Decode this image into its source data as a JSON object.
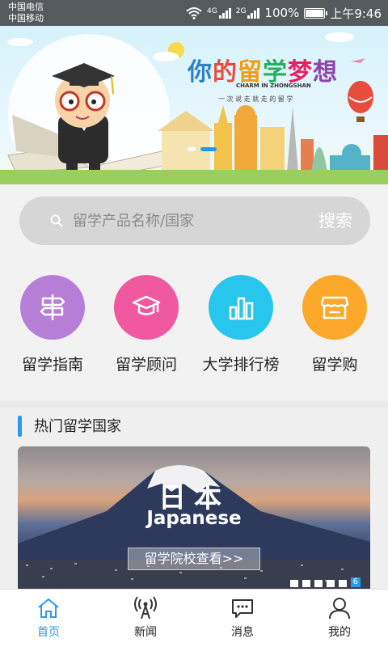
{
  "status_bar": {
    "carrier_1": "中国电信",
    "carrier_2": "中国移动",
    "net_1": "4G",
    "net_2": "2G",
    "battery": "100%",
    "time": "上午9:46"
  },
  "banner": {
    "title": [
      "你",
      "的",
      "留",
      "学",
      "梦",
      "想"
    ],
    "subtitle": "CHARM IN ZHONGSHAN",
    "slogan": "一 次 说 走 就 走 的 留 学"
  },
  "search": {
    "placeholder": "留学产品名称/国家",
    "button_label": "搜索"
  },
  "categories": [
    {
      "label": "留学指南",
      "color": "#b67ed6",
      "icon": "signpost-icon"
    },
    {
      "label": "留学顾问",
      "color": "#f058a0",
      "icon": "graduation-cap-icon"
    },
    {
      "label": "大学排行榜",
      "color": "#28c6ec",
      "icon": "bar-chart-icon"
    },
    {
      "label": "留学购",
      "color": "#fca82b",
      "icon": "storefront-icon"
    }
  ],
  "hot_countries": {
    "title": "热门留学国家",
    "card": {
      "country": "日本",
      "country_en": "Japanese",
      "link": "留学院校查看>>",
      "page_badge": "6"
    }
  },
  "bottom_nav": [
    {
      "label": "首页",
      "icon": "home-icon",
      "active": true
    },
    {
      "label": "新闻",
      "icon": "broadcast-icon",
      "active": false
    },
    {
      "label": "消息",
      "icon": "chat-icon",
      "active": false
    },
    {
      "label": "我的",
      "icon": "user-icon",
      "active": false
    }
  ],
  "colors": {
    "accent": "#2a9af0",
    "status_bar": "#555a5f",
    "search_bg": "#d6d6d6"
  }
}
